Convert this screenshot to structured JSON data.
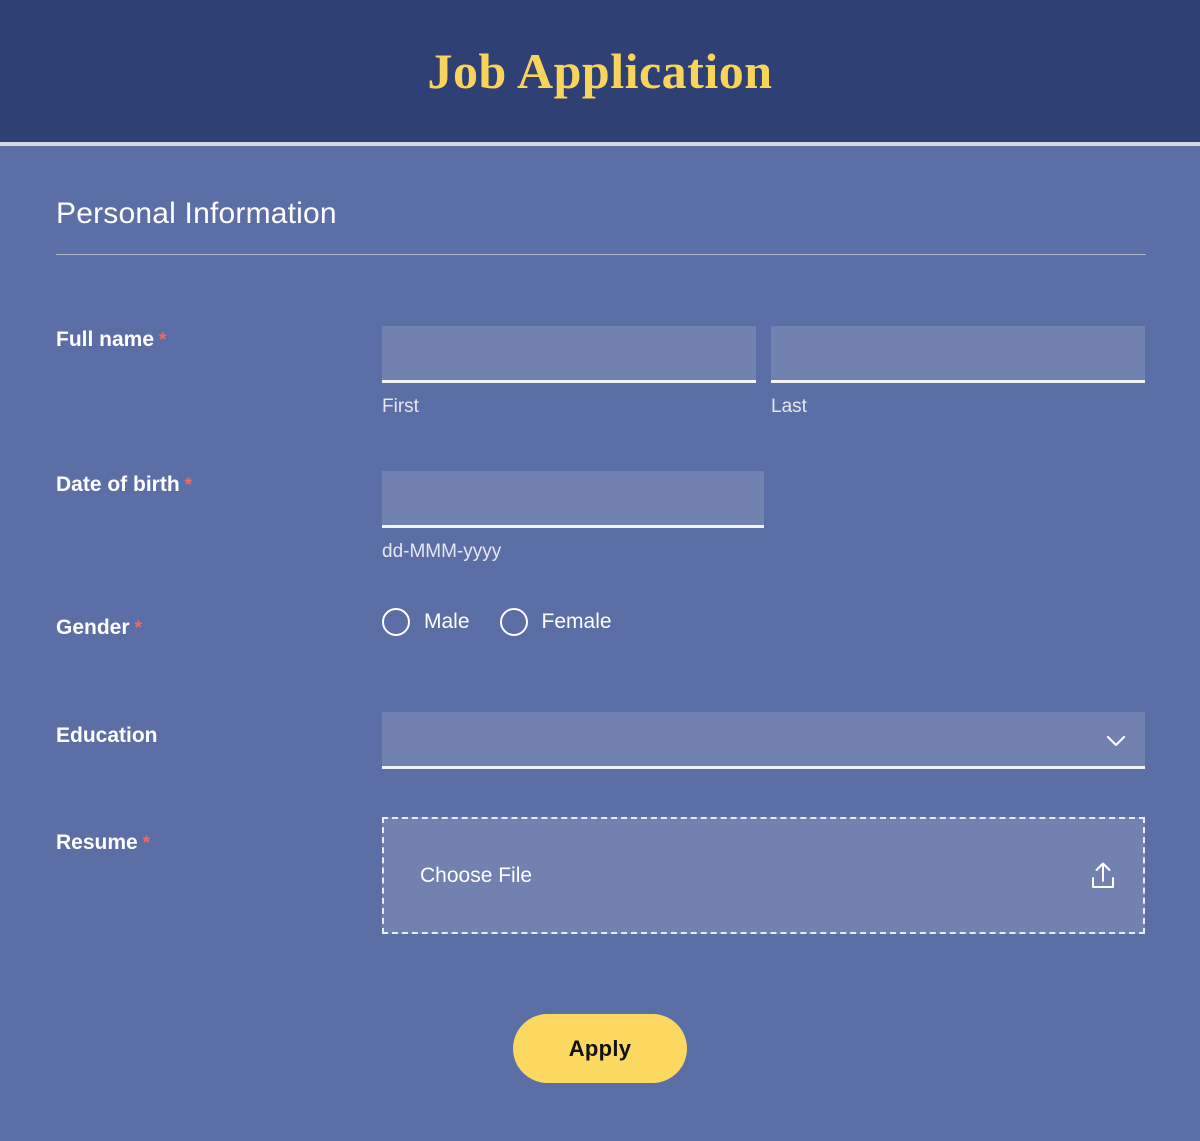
{
  "header": {
    "title": "Job Application",
    "background_color": "#2e4074",
    "title_color": "#f8d45c"
  },
  "theme": {
    "body_background": "#5b6ea5",
    "input_background": "#7181b0",
    "accent_yellow": "#fbd960",
    "required_asterisk_color": "#f2685d",
    "text_color": "#ffffff"
  },
  "section": {
    "title": "Personal Information"
  },
  "fields": {
    "full_name": {
      "label": "Full name",
      "required_marker": "*",
      "first": {
        "value": "",
        "placeholder": "",
        "sublabel": "First"
      },
      "last": {
        "value": "",
        "placeholder": "",
        "sublabel": "Last"
      }
    },
    "date_of_birth": {
      "label": "Date of birth",
      "required_marker": "*",
      "value": "",
      "placeholder": "",
      "sublabel": "dd-MMM-yyyy"
    },
    "gender": {
      "label": "Gender",
      "required_marker": "*",
      "options": [
        {
          "label": "Male",
          "selected": false
        },
        {
          "label": "Female",
          "selected": false
        }
      ]
    },
    "education": {
      "label": "Education",
      "required_marker": "",
      "selected_value": "",
      "icon": "chevron-down-icon"
    },
    "resume": {
      "label": "Resume",
      "required_marker": "*",
      "choose_file_label": "Choose File",
      "icon": "upload-icon"
    }
  },
  "actions": {
    "apply_label": "Apply"
  }
}
